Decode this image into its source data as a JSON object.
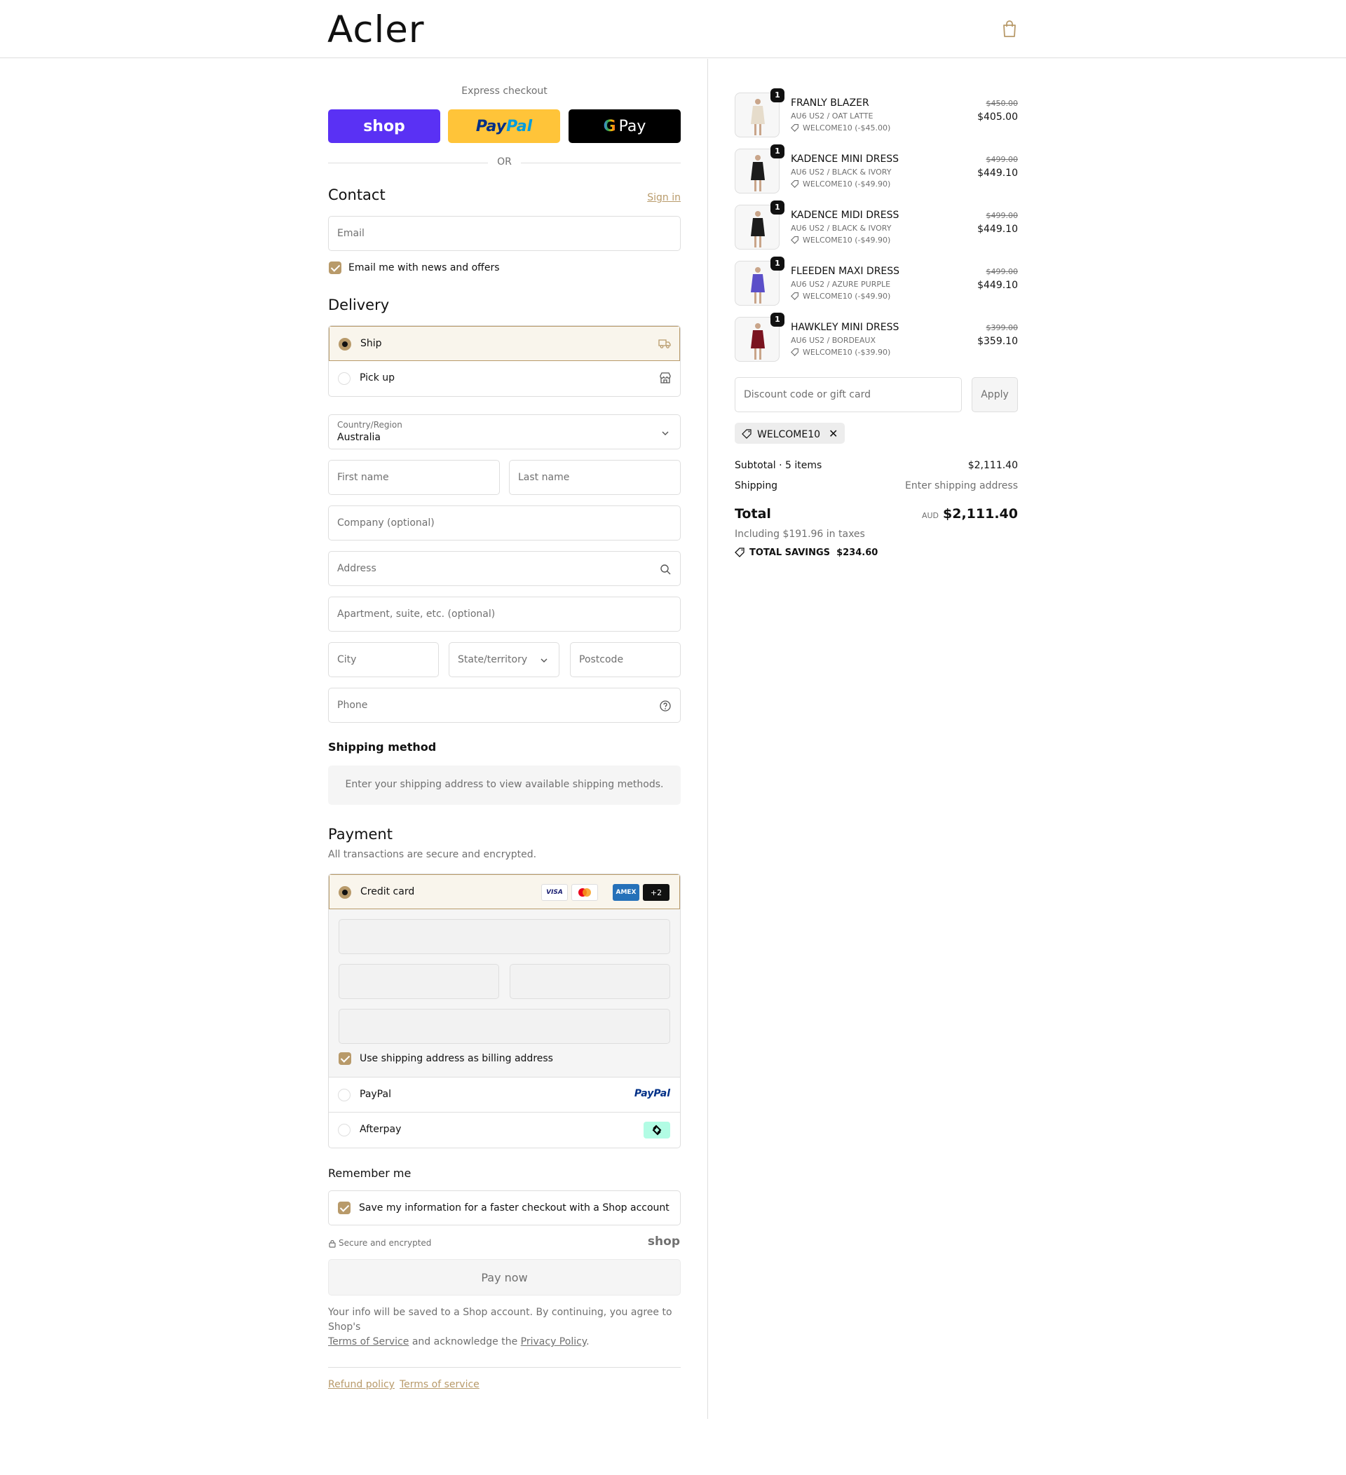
{
  "brand": {
    "logo": "Acler",
    "accent": "#b89a6a"
  },
  "express": {
    "title": "Express checkout",
    "shop_label": "shop",
    "paypal_part1": "Pay",
    "paypal_part2": "Pal",
    "gpay_label": "Pay",
    "or": "OR"
  },
  "contact": {
    "title": "Contact",
    "sign_in": "Sign in",
    "email_placeholder": "Email",
    "news_label": "Email me with news and offers"
  },
  "delivery": {
    "title": "Delivery",
    "ship": "Ship",
    "pickup": "Pick up",
    "country_label": "Country/Region",
    "country_value": "Australia",
    "first_name": "First name",
    "last_name": "Last name",
    "company": "Company (optional)",
    "address": "Address",
    "apartment": "Apartment, suite, etc. (optional)",
    "city": "City",
    "state": "State/territory",
    "postcode": "Postcode",
    "phone": "Phone"
  },
  "shipping_method": {
    "title": "Shipping method",
    "notice": "Enter your shipping address to view available shipping methods."
  },
  "payment": {
    "title": "Payment",
    "subtitle": "All transactions are secure and encrypted.",
    "credit_card": "Credit card",
    "card_logos": [
      "VISA",
      "",
      "AMEX",
      "+2"
    ],
    "billing_same": "Use shipping address as billing address",
    "paypal": "PayPal",
    "paypal_logo": "PayPal",
    "afterpay": "Afterpay"
  },
  "remember": {
    "title": "Remember me",
    "save_label": "Save my information for a faster checkout with a Shop account",
    "secure": "Secure and encrypted",
    "shop_logo": "shop"
  },
  "pay_now": "Pay now",
  "legal": {
    "line1": "Your info will be saved to a Shop account. By continuing, you agree to Shop's",
    "terms": "Terms of Service",
    "mid": "and acknowledge the",
    "privacy": "Privacy Policy",
    "end": "."
  },
  "footer": {
    "refund": "Refund policy",
    "terms": "Terms of service"
  },
  "order": {
    "items": [
      {
        "qty": "1",
        "name": "FRANLY BLAZER",
        "variant": "AU6 US2 / OAT LATTE",
        "discount": "WELCOME10 (-$45.00)",
        "orig": "$450.00",
        "price": "$405.00",
        "color": "#e6dccb"
      },
      {
        "qty": "1",
        "name": "KADENCE MINI DRESS",
        "variant": "AU6 US2 / BLACK & IVORY",
        "discount": "WELCOME10 (-$49.90)",
        "orig": "$499.00",
        "price": "$449.10",
        "color": "#1c1c1c"
      },
      {
        "qty": "1",
        "name": "KADENCE MIDI DRESS",
        "variant": "AU6 US2 / BLACK & IVORY",
        "discount": "WELCOME10 (-$49.90)",
        "orig": "$499.00",
        "price": "$449.10",
        "color": "#1c1c1c"
      },
      {
        "qty": "1",
        "name": "FLEEDEN MAXI DRESS",
        "variant": "AU6 US2 / AZURE PURPLE",
        "discount": "WELCOME10 (-$49.90)",
        "orig": "$499.00",
        "price": "$449.10",
        "color": "#5b4fc9"
      },
      {
        "qty": "1",
        "name": "HAWKLEY MINI DRESS",
        "variant": "AU6 US2 / BORDEAUX",
        "discount": "WELCOME10 (-$39.90)",
        "orig": "$399.00",
        "price": "$359.10",
        "color": "#7a1420"
      }
    ],
    "discount_placeholder": "Discount code or gift card",
    "apply": "Apply",
    "applied_code": "WELCOME10",
    "subtotal_label": "Subtotal · 5 items",
    "subtotal": "$2,111.40",
    "shipping_label": "Shipping",
    "shipping_value": "Enter shipping address",
    "total_label": "Total",
    "currency": "AUD",
    "total": "$2,111.40",
    "taxes": "Including $191.96 in taxes",
    "savings_label": "TOTAL SAVINGS",
    "savings": "$234.60"
  }
}
